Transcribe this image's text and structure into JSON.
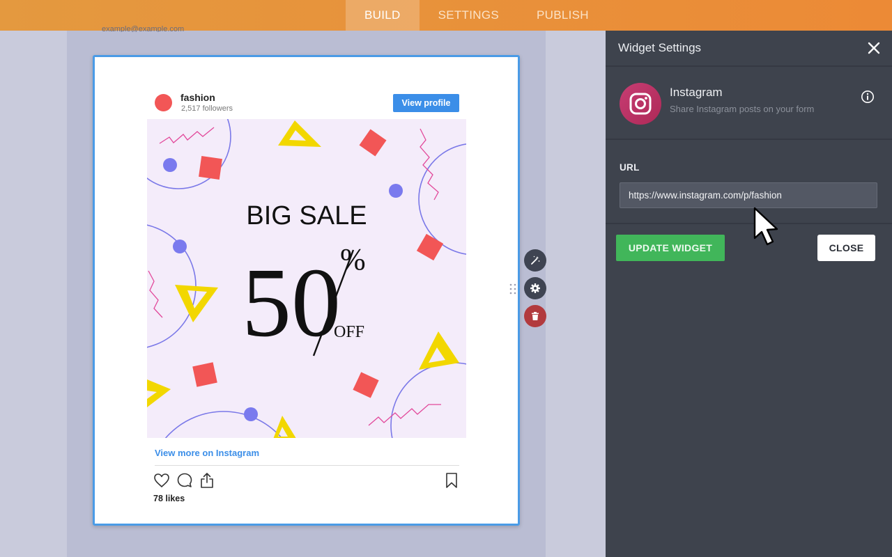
{
  "topbar": {
    "tabs": [
      {
        "label": "BUILD",
        "active": true
      },
      {
        "label": "SETTINGS",
        "active": false
      },
      {
        "label": "PUBLISH",
        "active": false
      }
    ]
  },
  "canvas": {
    "cut_text": "example@example.com"
  },
  "post": {
    "username": "fashion",
    "followers": "2,517 followers",
    "view_profile": "View profile",
    "image": {
      "headline": "BIG SALE",
      "number": "50",
      "percent": "%",
      "off": "OFF"
    },
    "view_more": "View more on Instagram",
    "likes": "78 likes"
  },
  "widget_tools": {
    "icons": [
      "wand-icon",
      "gear-icon",
      "trash-icon"
    ]
  },
  "panel": {
    "title": "Widget Settings",
    "widget_name": "Instagram",
    "widget_desc": "Share Instagram posts on your form",
    "url_label": "URL",
    "url_value": "https://www.instagram.com/p/fashion",
    "update_label": "UPDATE WIDGET",
    "close_label": "CLOSE"
  },
  "colors": {
    "topbar": "#ec8a36",
    "accent_blue": "#3b8ee8",
    "panel_bg": "#3e434d",
    "update_green": "#41b65a",
    "instagram_pink": "#c73d73"
  }
}
